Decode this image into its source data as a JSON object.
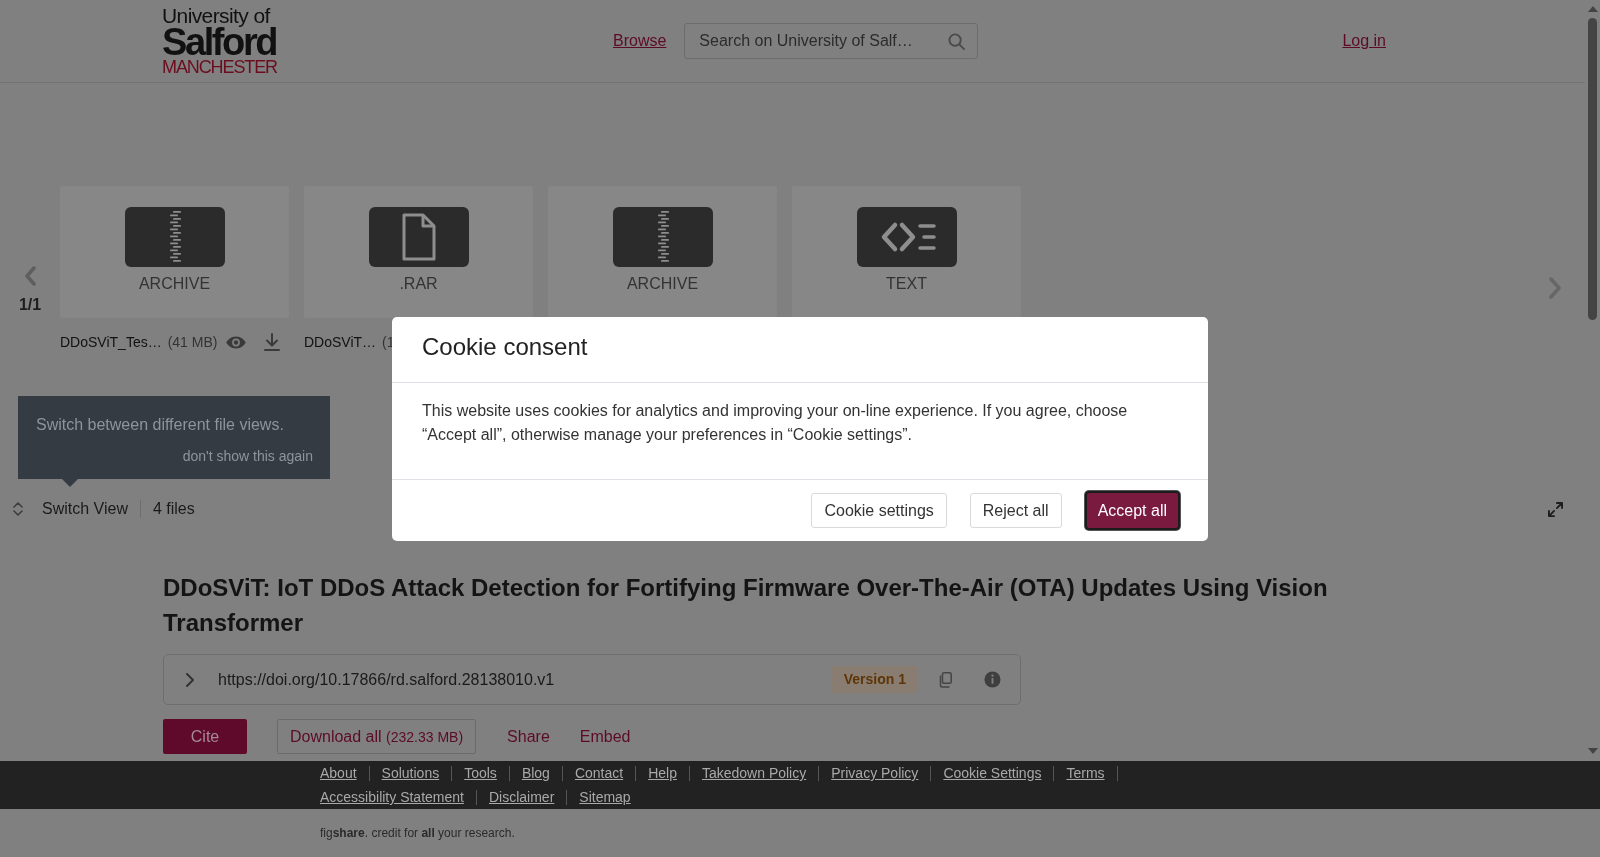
{
  "header": {
    "logo": {
      "line_1": "University of",
      "line_2": "Salford",
      "line_3": "MANCHESTER"
    },
    "browse": "Browse",
    "search": {
      "placeholder": "Search on University of Salf…"
    },
    "login": "Log in"
  },
  "carousel": {
    "page": "1/1",
    "files": [
      {
        "kind": "archive",
        "type": "ARCHIVE",
        "name": "DDoSViT_Tes…",
        "size": "(41 MB)",
        "actions": [
          {
            "kind": "view"
          },
          {
            "kind": "download"
          }
        ]
      },
      {
        "kind": "document",
        "type": ".RAR",
        "name": "DDoSViT…",
        "size": "(1"
      },
      {
        "kind": "archive",
        "type": "ARCHIVE"
      },
      {
        "kind": "code",
        "type": "TEXT"
      }
    ]
  },
  "tooltip": {
    "text": "Switch between different file views.",
    "dismiss": "don't show this again"
  },
  "file_bar": {
    "switch_view": "Switch View",
    "file_count": "4 files"
  },
  "item": {
    "title": "DDoSViT: IoT DDoS Attack Detection for Fortifying Firmware Over-The-Air (OTA) Updates Using Vision Transformer",
    "doi": "https://doi.org/10.17866/rd.salford.28138010.v1",
    "version": "Version 1",
    "actions": {
      "cite": "Cite",
      "download": "Download all",
      "download_size": "(232.33 MB)",
      "share": "Share",
      "embed": "Embed"
    }
  },
  "footer": {
    "links": [
      "About",
      "Solutions",
      "Tools",
      "Blog",
      "Contact",
      "Help",
      "Takedown Policy",
      "Privacy Policy",
      "Cookie Settings",
      "Terms",
      "Accessibility Statement",
      "Disclaimer",
      "Sitemap"
    ],
    "tagline": "fig**share**. credit for **all** your research."
  },
  "cookie_dialog": {
    "title": "Cookie consent",
    "text": "This website uses cookies for analytics and improving your on-line experience. If you agree, choose “Accept all”, otherwise manage your preferences in “Cookie settings”.",
    "buttons": [
      {
        "label": "Cookie settings",
        "kind": "secondary",
        "focused": false
      },
      {
        "label": "Reject all",
        "kind": "secondary",
        "focused": false
      },
      {
        "label": "Accept all",
        "kind": "primary",
        "focused": true
      }
    ]
  }
}
